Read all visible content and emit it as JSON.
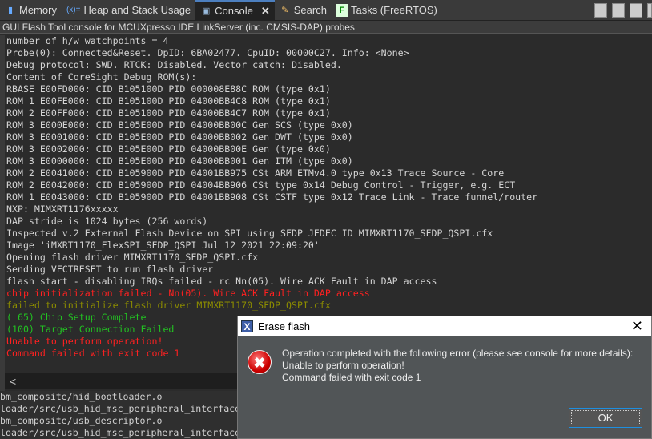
{
  "tabs": [
    {
      "label": "Memory"
    },
    {
      "label": "Heap and Stack Usage",
      "icon_text": "(x)="
    },
    {
      "label": "Console",
      "active": true
    },
    {
      "label": "Search"
    },
    {
      "label": "Tasks (FreeRTOS)"
    }
  ],
  "console_title": "GUI Flash Tool console for MCUXpresso IDE LinkServer (inc. CMSIS-DAP) probes",
  "console": {
    "lines": [
      {
        "text": "number of h/w watchpoints = 4",
        "color": ""
      },
      {
        "text": "Probe(0): Connected&Reset. DpID: 6BA02477. CpuID: 00000C27. Info: <None>",
        "color": ""
      },
      {
        "text": "Debug protocol: SWD. RTCK: Disabled. Vector catch: Disabled.",
        "color": ""
      },
      {
        "text": "Content of CoreSight Debug ROM(s):",
        "color": ""
      },
      {
        "text": "RBASE E00FD000: CID B105100D PID 000008E88C ROM (type 0x1)",
        "color": ""
      },
      {
        "text": "ROM 1 E00FE000: CID B105100D PID 04000BB4C8 ROM (type 0x1)",
        "color": ""
      },
      {
        "text": "ROM 2 E00FF000: CID B105100D PID 04000BB4C7 ROM (type 0x1)",
        "color": ""
      },
      {
        "text": "ROM 3 E000E000: CID B105E00D PID 04000BB00C Gen SCS (type 0x0)",
        "color": ""
      },
      {
        "text": "ROM 3 E0001000: CID B105E00D PID 04000BB002 Gen DWT (type 0x0)",
        "color": ""
      },
      {
        "text": "ROM 3 E0002000: CID B105E00D PID 04000BB00E Gen (type 0x0)",
        "color": ""
      },
      {
        "text": "ROM 3 E0000000: CID B105E00D PID 04000BB001 Gen ITM (type 0x0)",
        "color": ""
      },
      {
        "text": "ROM 2 E0041000: CID B105900D PID 04001BB975 CSt ARM ETMv4.0 type 0x13 Trace Source - Core",
        "color": ""
      },
      {
        "text": "ROM 2 E0042000: CID B105900D PID 04004BB906 CSt type 0x14 Debug Control - Trigger, e.g. ECT",
        "color": ""
      },
      {
        "text": "ROM 1 E0043000: CID B105900D PID 04001BB908 CSt CSTF type 0x12 Trace Link - Trace funnel/router",
        "color": ""
      },
      {
        "text": "NXP: MIMXRT1176xxxxx",
        "color": ""
      },
      {
        "text": "DAP stride is 1024 bytes (256 words)",
        "color": ""
      },
      {
        "text": "Inspected v.2 External Flash Device on SPI using SFDP JEDEC ID MIMXRT1170_SFDP_QSPI.cfx",
        "color": ""
      },
      {
        "text": "Image 'iMXRT1170_FlexSPI_SFDP_QSPI Jul 12 2021 22:09:20'",
        "color": ""
      },
      {
        "text": "Opening flash driver MIMXRT1170_SFDP_QSPI.cfx",
        "color": ""
      },
      {
        "text": "Sending VECTRESET to run flash driver",
        "color": ""
      },
      {
        "text": "flash start - disabling IRQs failed - rc Nn(05). Wire ACK Fault in DAP access",
        "color": ""
      },
      {
        "text": "chip initialization failed - Nn(05). Wire ACK Fault in DAP access",
        "color": "red"
      },
      {
        "text": "failed to initialize flash driver MIMXRT1170_SFDP_QSPI.cfx",
        "color": "olive"
      },
      {
        "text": "( 65) Chip Setup Complete",
        "color": "green"
      },
      {
        "text": "(100) Target Connection Failed",
        "color": "green"
      },
      {
        "text": "Unable to perform operation!",
        "color": "red"
      },
      {
        "text": "Command failed with exit code 1",
        "color": "red"
      }
    ]
  },
  "scroll_left": "<",
  "build_output": [
    "bm_composite/hid_bootloader.o",
    "loader/src/usb_hid_msc_peripheral_interface.o",
    "bm_composite/usb_descriptor.o",
    "loader/src/usb_hid_msc_peripheral_interface.o"
  ],
  "dialog": {
    "title": "Erase flash",
    "logo": "X",
    "close": "✕",
    "icon": "✖",
    "message": [
      "Operation completed with the following error (please see console for more details):",
      "Unable to perform operation!",
      "Command failed with exit code 1"
    ],
    "ok": "OK"
  }
}
